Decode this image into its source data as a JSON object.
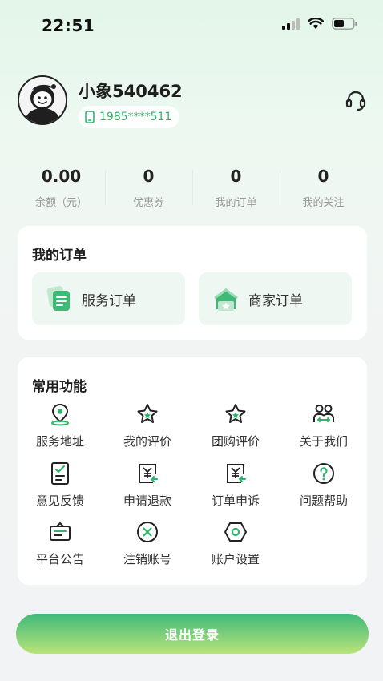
{
  "status_bar": {
    "time": "22:51"
  },
  "profile": {
    "username": "小象540462",
    "phone": "1985****511"
  },
  "stats": [
    {
      "value": "0.00",
      "label": "余额（元）"
    },
    {
      "value": "0",
      "label": "优惠券"
    },
    {
      "value": "0",
      "label": "我的订单"
    },
    {
      "value": "0",
      "label": "我的关注"
    }
  ],
  "orders": {
    "title": "我的订单",
    "items": [
      {
        "label": "服务订单",
        "icon": "service-order-icon"
      },
      {
        "label": "商家订单",
        "icon": "merchant-order-icon"
      }
    ]
  },
  "features": {
    "title": "常用功能",
    "items": [
      {
        "label": "服务地址",
        "icon": "location-pin-icon"
      },
      {
        "label": "我的评价",
        "icon": "star-icon"
      },
      {
        "label": "团购评价",
        "icon": "star-icon"
      },
      {
        "label": "关于我们",
        "icon": "people-icon"
      },
      {
        "label": "意见反馈",
        "icon": "feedback-icon"
      },
      {
        "label": "申请退款",
        "icon": "refund-icon"
      },
      {
        "label": "订单申诉",
        "icon": "appeal-icon"
      },
      {
        "label": "问题帮助",
        "icon": "help-icon"
      },
      {
        "label": "平台公告",
        "icon": "announcement-icon"
      },
      {
        "label": "注销账号",
        "icon": "close-circle-icon"
      },
      {
        "label": "账户设置",
        "icon": "settings-icon"
      }
    ]
  },
  "logout_label": "退出登录",
  "colors": {
    "accent": "#2db56a",
    "icon_dark": "#222222",
    "gradient_end": "#b9e37a"
  }
}
